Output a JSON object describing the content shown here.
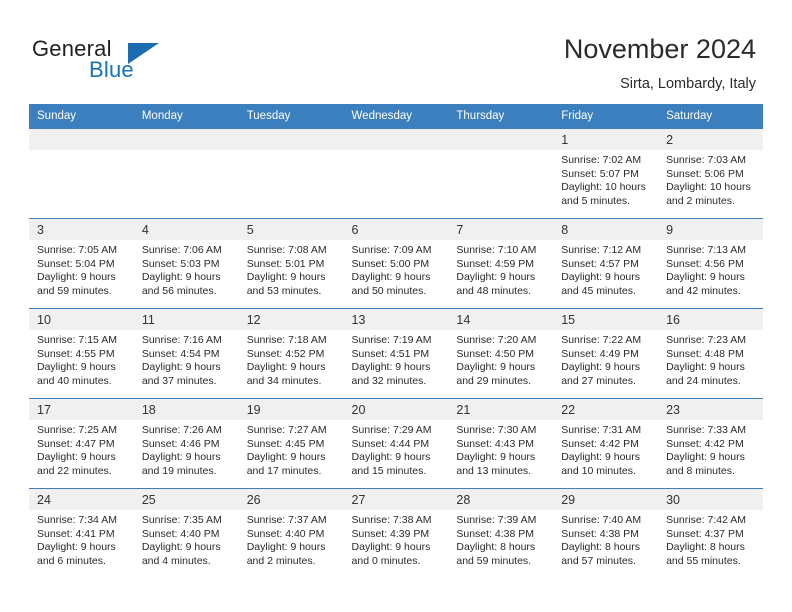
{
  "brand": {
    "name_top": "General",
    "name_bottom": "Blue",
    "triangle_color": "#1b6cb0",
    "text_color": "#231f20",
    "blue_color": "#1673be"
  },
  "header": {
    "title": "November 2024",
    "subtitle": "Sirta, Lombardy, Italy"
  },
  "theme": {
    "header_bg": "#3c7fbe",
    "header_text": "#ffffff",
    "daynum_bg": "#f0f0f0",
    "cell_bg": "#ffffff",
    "grid_line": "#3c7fbe"
  },
  "weekdays": [
    "Sunday",
    "Monday",
    "Tuesday",
    "Wednesday",
    "Thursday",
    "Friday",
    "Saturday"
  ],
  "labels": {
    "sunrise_prefix": "Sunrise:",
    "sunset_prefix": "Sunset:",
    "daylight_prefix": "Daylight:"
  },
  "weeks": [
    [
      {
        "day": "",
        "line1": "",
        "line2": "",
        "line3": "",
        "line4": ""
      },
      {
        "day": "",
        "line1": "",
        "line2": "",
        "line3": "",
        "line4": ""
      },
      {
        "day": "",
        "line1": "",
        "line2": "",
        "line3": "",
        "line4": ""
      },
      {
        "day": "",
        "line1": "",
        "line2": "",
        "line3": "",
        "line4": ""
      },
      {
        "day": "",
        "line1": "",
        "line2": "",
        "line3": "",
        "line4": ""
      },
      {
        "day": "1",
        "line1": "Sunrise: 7:02 AM",
        "line2": "Sunset: 5:07 PM",
        "line3": "Daylight: 10 hours",
        "line4": "and 5 minutes."
      },
      {
        "day": "2",
        "line1": "Sunrise: 7:03 AM",
        "line2": "Sunset: 5:06 PM",
        "line3": "Daylight: 10 hours",
        "line4": "and 2 minutes."
      }
    ],
    [
      {
        "day": "3",
        "line1": "Sunrise: 7:05 AM",
        "line2": "Sunset: 5:04 PM",
        "line3": "Daylight: 9 hours",
        "line4": "and 59 minutes."
      },
      {
        "day": "4",
        "line1": "Sunrise: 7:06 AM",
        "line2": "Sunset: 5:03 PM",
        "line3": "Daylight: 9 hours",
        "line4": "and 56 minutes."
      },
      {
        "day": "5",
        "line1": "Sunrise: 7:08 AM",
        "line2": "Sunset: 5:01 PM",
        "line3": "Daylight: 9 hours",
        "line4": "and 53 minutes."
      },
      {
        "day": "6",
        "line1": "Sunrise: 7:09 AM",
        "line2": "Sunset: 5:00 PM",
        "line3": "Daylight: 9 hours",
        "line4": "and 50 minutes."
      },
      {
        "day": "7",
        "line1": "Sunrise: 7:10 AM",
        "line2": "Sunset: 4:59 PM",
        "line3": "Daylight: 9 hours",
        "line4": "and 48 minutes."
      },
      {
        "day": "8",
        "line1": "Sunrise: 7:12 AM",
        "line2": "Sunset: 4:57 PM",
        "line3": "Daylight: 9 hours",
        "line4": "and 45 minutes."
      },
      {
        "day": "9",
        "line1": "Sunrise: 7:13 AM",
        "line2": "Sunset: 4:56 PM",
        "line3": "Daylight: 9 hours",
        "line4": "and 42 minutes."
      }
    ],
    [
      {
        "day": "10",
        "line1": "Sunrise: 7:15 AM",
        "line2": "Sunset: 4:55 PM",
        "line3": "Daylight: 9 hours",
        "line4": "and 40 minutes."
      },
      {
        "day": "11",
        "line1": "Sunrise: 7:16 AM",
        "line2": "Sunset: 4:54 PM",
        "line3": "Daylight: 9 hours",
        "line4": "and 37 minutes."
      },
      {
        "day": "12",
        "line1": "Sunrise: 7:18 AM",
        "line2": "Sunset: 4:52 PM",
        "line3": "Daylight: 9 hours",
        "line4": "and 34 minutes."
      },
      {
        "day": "13",
        "line1": "Sunrise: 7:19 AM",
        "line2": "Sunset: 4:51 PM",
        "line3": "Daylight: 9 hours",
        "line4": "and 32 minutes."
      },
      {
        "day": "14",
        "line1": "Sunrise: 7:20 AM",
        "line2": "Sunset: 4:50 PM",
        "line3": "Daylight: 9 hours",
        "line4": "and 29 minutes."
      },
      {
        "day": "15",
        "line1": "Sunrise: 7:22 AM",
        "line2": "Sunset: 4:49 PM",
        "line3": "Daylight: 9 hours",
        "line4": "and 27 minutes."
      },
      {
        "day": "16",
        "line1": "Sunrise: 7:23 AM",
        "line2": "Sunset: 4:48 PM",
        "line3": "Daylight: 9 hours",
        "line4": "and 24 minutes."
      }
    ],
    [
      {
        "day": "17",
        "line1": "Sunrise: 7:25 AM",
        "line2": "Sunset: 4:47 PM",
        "line3": "Daylight: 9 hours",
        "line4": "and 22 minutes."
      },
      {
        "day": "18",
        "line1": "Sunrise: 7:26 AM",
        "line2": "Sunset: 4:46 PM",
        "line3": "Daylight: 9 hours",
        "line4": "and 19 minutes."
      },
      {
        "day": "19",
        "line1": "Sunrise: 7:27 AM",
        "line2": "Sunset: 4:45 PM",
        "line3": "Daylight: 9 hours",
        "line4": "and 17 minutes."
      },
      {
        "day": "20",
        "line1": "Sunrise: 7:29 AM",
        "line2": "Sunset: 4:44 PM",
        "line3": "Daylight: 9 hours",
        "line4": "and 15 minutes."
      },
      {
        "day": "21",
        "line1": "Sunrise: 7:30 AM",
        "line2": "Sunset: 4:43 PM",
        "line3": "Daylight: 9 hours",
        "line4": "and 13 minutes."
      },
      {
        "day": "22",
        "line1": "Sunrise: 7:31 AM",
        "line2": "Sunset: 4:42 PM",
        "line3": "Daylight: 9 hours",
        "line4": "and 10 minutes."
      },
      {
        "day": "23",
        "line1": "Sunrise: 7:33 AM",
        "line2": "Sunset: 4:42 PM",
        "line3": "Daylight: 9 hours",
        "line4": "and 8 minutes."
      }
    ],
    [
      {
        "day": "24",
        "line1": "Sunrise: 7:34 AM",
        "line2": "Sunset: 4:41 PM",
        "line3": "Daylight: 9 hours",
        "line4": "and 6 minutes."
      },
      {
        "day": "25",
        "line1": "Sunrise: 7:35 AM",
        "line2": "Sunset: 4:40 PM",
        "line3": "Daylight: 9 hours",
        "line4": "and 4 minutes."
      },
      {
        "day": "26",
        "line1": "Sunrise: 7:37 AM",
        "line2": "Sunset: 4:40 PM",
        "line3": "Daylight: 9 hours",
        "line4": "and 2 minutes."
      },
      {
        "day": "27",
        "line1": "Sunrise: 7:38 AM",
        "line2": "Sunset: 4:39 PM",
        "line3": "Daylight: 9 hours",
        "line4": "and 0 minutes."
      },
      {
        "day": "28",
        "line1": "Sunrise: 7:39 AM",
        "line2": "Sunset: 4:38 PM",
        "line3": "Daylight: 8 hours",
        "line4": "and 59 minutes."
      },
      {
        "day": "29",
        "line1": "Sunrise: 7:40 AM",
        "line2": "Sunset: 4:38 PM",
        "line3": "Daylight: 8 hours",
        "line4": "and 57 minutes."
      },
      {
        "day": "30",
        "line1": "Sunrise: 7:42 AM",
        "line2": "Sunset: 4:37 PM",
        "line3": "Daylight: 8 hours",
        "line4": "and 55 minutes."
      }
    ]
  ]
}
